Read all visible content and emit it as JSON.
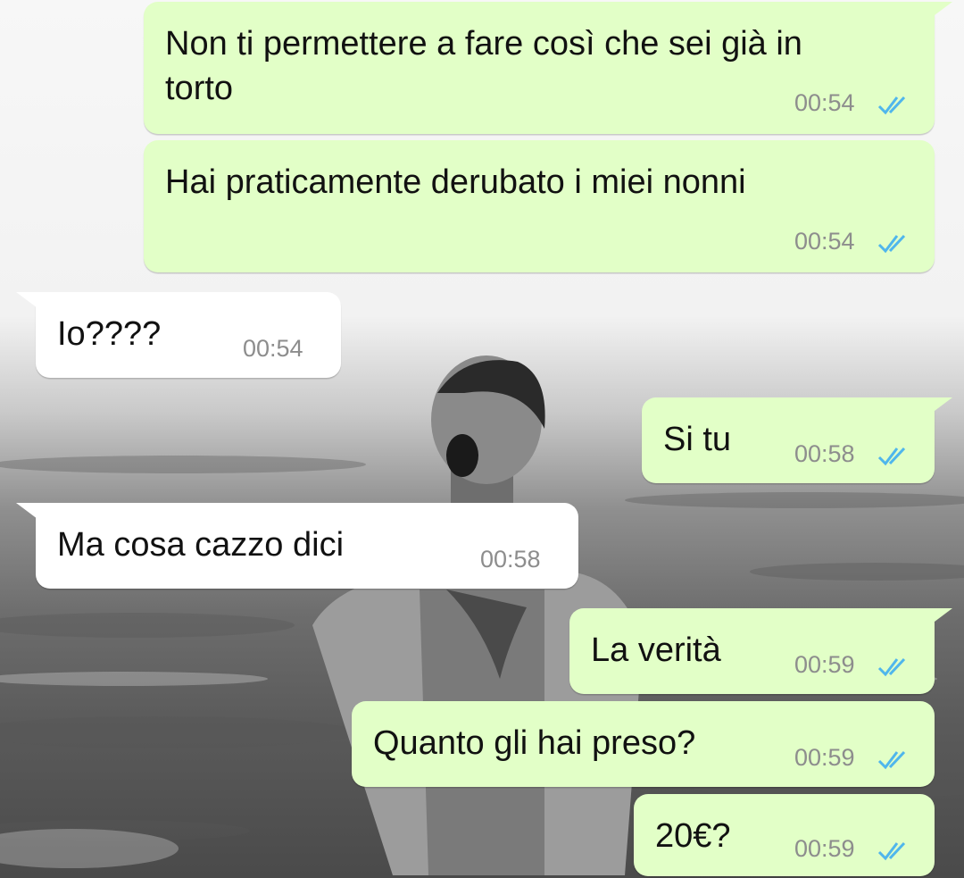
{
  "chat": {
    "messages": [
      {
        "id": "m1",
        "direction": "outgoing",
        "text_lines": [
          "Non ti permettere a fare così che sei già in",
          "torto"
        ],
        "time": "00:54",
        "status": "read-icon"
      },
      {
        "id": "m2",
        "direction": "outgoing",
        "text_lines": [
          "Hai praticamente derubato i miei nonni"
        ],
        "time": "00:54",
        "status": "read-icon"
      },
      {
        "id": "m3",
        "direction": "incoming",
        "text_lines": [
          "Io????"
        ],
        "time": "00:54"
      },
      {
        "id": "m4",
        "direction": "outgoing",
        "text_lines": [
          "Si tu"
        ],
        "time": "00:58",
        "status": "read-icon"
      },
      {
        "id": "m5",
        "direction": "incoming",
        "text_lines": [
          "Ma cosa cazzo dici"
        ],
        "time": "00:58"
      },
      {
        "id": "m6",
        "direction": "outgoing",
        "text_lines": [
          "La verità"
        ],
        "time": "00:59",
        "status": "read-icon"
      },
      {
        "id": "m7",
        "direction": "outgoing",
        "text_lines": [
          "Quanto gli hai preso?"
        ],
        "time": "00:59",
        "status": "read-icon"
      },
      {
        "id": "m8",
        "direction": "outgoing",
        "text_lines": [
          "20€?"
        ],
        "time": "00:59",
        "status": "read-icon"
      }
    ]
  },
  "colors": {
    "outgoing_bubble": "#e2ffc7",
    "incoming_bubble": "#ffffff",
    "timestamp": "#8d8d8d",
    "read_ticks": "#4fb6ec"
  },
  "wallpaper": {
    "icon": "beach-photo-wallpaper"
  }
}
